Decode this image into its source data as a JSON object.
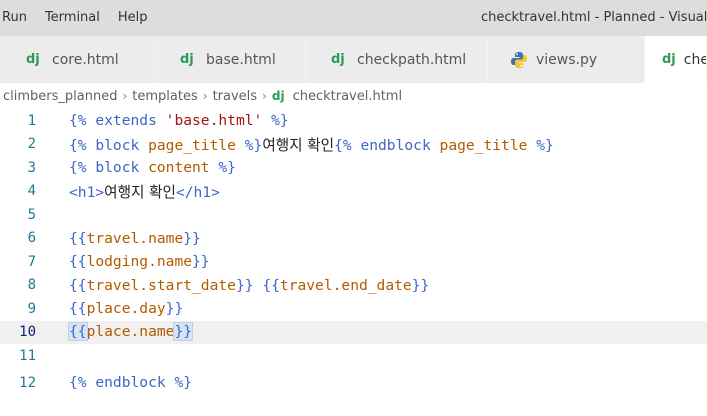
{
  "menubar": {
    "items": [
      "Run",
      "Terminal",
      "Help"
    ],
    "window_title": "checktravel.html - Planned - Visual"
  },
  "tabs": [
    {
      "icon": "dj",
      "label": "core.html",
      "active": false
    },
    {
      "icon": "dj",
      "label": "base.html",
      "active": false
    },
    {
      "icon": "dj",
      "label": "checkpath.html",
      "active": false
    },
    {
      "icon": "python",
      "label": "views.py",
      "active": false
    },
    {
      "icon": "dj",
      "label": "che",
      "active": true
    }
  ],
  "breadcrumb": {
    "parts": [
      "climbers_planned",
      "templates",
      "travels"
    ],
    "file_icon": "dj",
    "file": "checktravel.html"
  },
  "editor": {
    "current_line": 10,
    "lines": [
      {
        "n": "1"
      },
      {
        "n": "2"
      },
      {
        "n": "3"
      },
      {
        "n": "4"
      },
      {
        "n": "5"
      },
      {
        "n": "6"
      },
      {
        "n": "7"
      },
      {
        "n": "8"
      },
      {
        "n": "9"
      },
      {
        "n": "10"
      },
      {
        "n": "11"
      },
      {
        "n": "12"
      }
    ],
    "tokens": {
      "l1": [
        "{% ",
        "extends",
        " 'base.html'",
        " %}"
      ],
      "l2": [
        "{% ",
        "block",
        " page_title",
        " %}",
        "여행지 확인",
        "{% ",
        "endblock",
        " page_title",
        " %}"
      ],
      "l3": [
        "{% ",
        "block",
        " content",
        " %}"
      ],
      "l4": [
        "<h1>",
        "여행지 확인",
        "</h1>"
      ],
      "l6": [
        "{{",
        "travel.name",
        "}}"
      ],
      "l7": [
        "{{",
        "lodging.name",
        "}}"
      ],
      "l8": [
        "{{",
        "travel.start_date",
        "}}",
        " ",
        "{{",
        "travel.end_date",
        "}}"
      ],
      "l9": [
        "{{",
        "place.day",
        "}}"
      ],
      "l10": [
        "{{",
        "place.name",
        "}}"
      ],
      "l12": [
        "{% ",
        "endblock",
        " %}"
      ]
    }
  }
}
